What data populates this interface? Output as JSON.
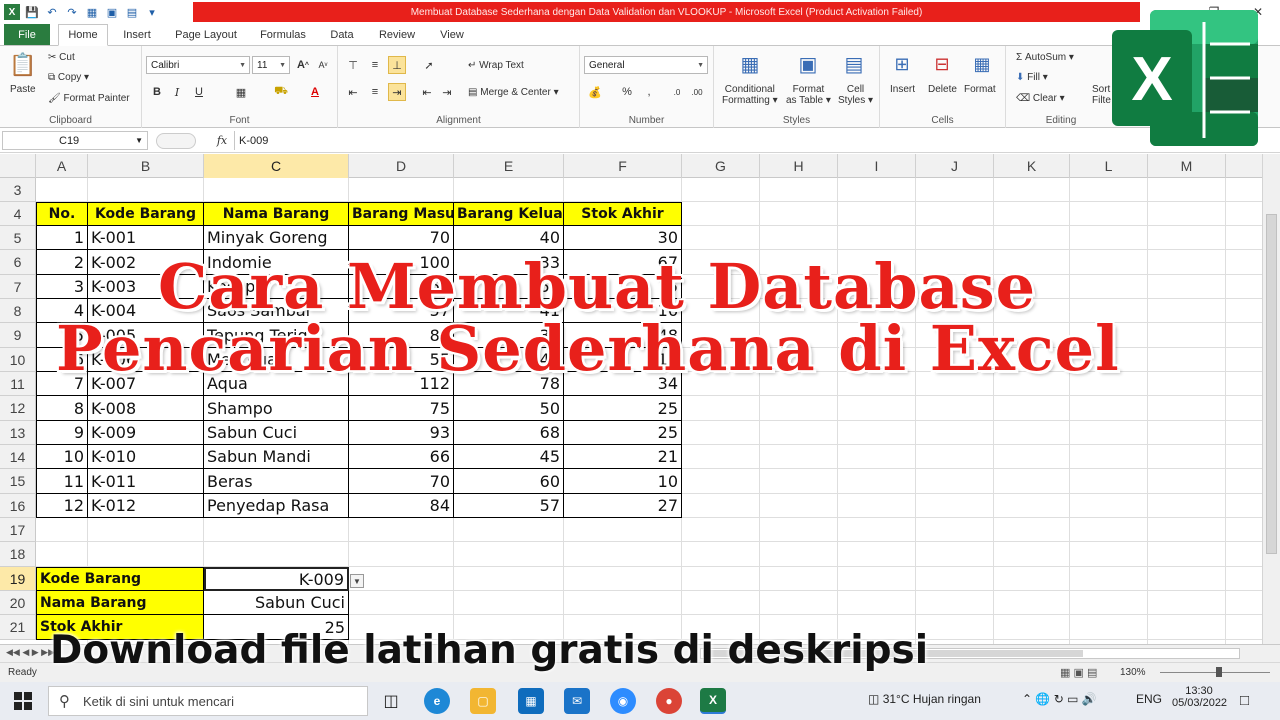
{
  "window": {
    "title": "Membuat Database Sederhana dengan Data Validation dan VLOOKUP  -  Microsoft Excel (Product Activation Failed)"
  },
  "tabs": [
    "File",
    "Home",
    "Insert",
    "Page Layout",
    "Formulas",
    "Data",
    "Review",
    "View"
  ],
  "ribbon": {
    "clipboard": {
      "paste": "Paste",
      "cut": "Cut",
      "copy": "Copy",
      "format_painter": "Format Painter",
      "label": "Clipboard"
    },
    "font": {
      "name": "Calibri",
      "size": "11",
      "label": "Font",
      "bold": "B",
      "italic": "I",
      "underline": "U"
    },
    "alignment": {
      "wrap": "Wrap Text",
      "merge": "Merge & Center",
      "label": "Alignment"
    },
    "number": {
      "format": "General",
      "label": "Number"
    },
    "styles": {
      "conditional": "Conditional",
      "conditional2": "Formatting",
      "format_as": "Format",
      "format_as2": "as Table",
      "cell": "Cell",
      "cell2": "Styles",
      "label": "Styles"
    },
    "cells": {
      "insert": "Insert",
      "delete": "Delete",
      "format": "Format",
      "label": "Cells"
    },
    "editing": {
      "autosum": "AutoSum",
      "fill": "Fill",
      "clear": "Clear",
      "sort": "Sort",
      "filter": "Filte",
      "label": "Editing"
    }
  },
  "formula_bar": {
    "name_box": "C19",
    "fx": "fx",
    "value": "K-009"
  },
  "columns": [
    "A",
    "B",
    "C",
    "D",
    "E",
    "F",
    "G",
    "H",
    "I",
    "J",
    "K",
    "L",
    "M"
  ],
  "rows": [
    "3",
    "4",
    "5",
    "6",
    "7",
    "8",
    "9",
    "10",
    "11",
    "12",
    "13",
    "14",
    "15",
    "16",
    "17",
    "18",
    "19",
    "20",
    "21"
  ],
  "table": {
    "headers": [
      "No.",
      "Kode Barang",
      "Nama Barang",
      "Barang Masuk",
      "Barang Keluar",
      "Stok Akhir"
    ],
    "rows": [
      [
        "1",
        "K-001",
        "Minyak Goreng",
        "70",
        "40",
        "30"
      ],
      [
        "2",
        "K-002",
        "Indomie",
        "100",
        "33",
        "67"
      ],
      [
        "3",
        "K-003",
        "Kecap",
        "65",
        "50",
        "15"
      ],
      [
        "4",
        "K-004",
        "Saos Sambal",
        "57",
        "41",
        "16"
      ],
      [
        "5",
        "K-005",
        "Tepung Terigu",
        "84",
        "36",
        "48"
      ],
      [
        "6",
        "K-006",
        "Mentega",
        "55",
        "42",
        "13"
      ],
      [
        "7",
        "K-007",
        "Aqua",
        "112",
        "78",
        "34"
      ],
      [
        "8",
        "K-008",
        "Shampo",
        "75",
        "50",
        "25"
      ],
      [
        "9",
        "K-009",
        "Sabun Cuci",
        "93",
        "68",
        "25"
      ],
      [
        "10",
        "K-010",
        "Sabun Mandi",
        "66",
        "45",
        "21"
      ],
      [
        "11",
        "K-011",
        "Beras",
        "70",
        "60",
        "10"
      ],
      [
        "12",
        "K-012",
        "Penyedap Rasa",
        "84",
        "57",
        "27"
      ]
    ]
  },
  "lookup": {
    "kode_label": "Kode Barang",
    "kode_value": "K-009",
    "nama_label": "Nama Barang",
    "nama_value": "Sabun Cuci",
    "stok_label": "Stok Akhir",
    "stok_value": "25"
  },
  "overlay": {
    "line1": "Cara Membuat Database",
    "line2": "Pencarian Sederhana di Excel",
    "bottom": "Download file latihan gratis di deskripsi",
    "logo_letter": "X"
  },
  "status": {
    "ready": "Ready",
    "zoom": "130%"
  },
  "taskbar": {
    "search_placeholder": "Ketik di sini untuk mencari",
    "weather": "31°C  Hujan ringan",
    "lang": "ENG",
    "time": "13:30",
    "date": "05/03/2022"
  },
  "colors": {
    "accent_green": "#2a7c3f",
    "title_red": "#e8201b",
    "header_yellow": "#ffff00",
    "selection": "#fde9a8"
  }
}
